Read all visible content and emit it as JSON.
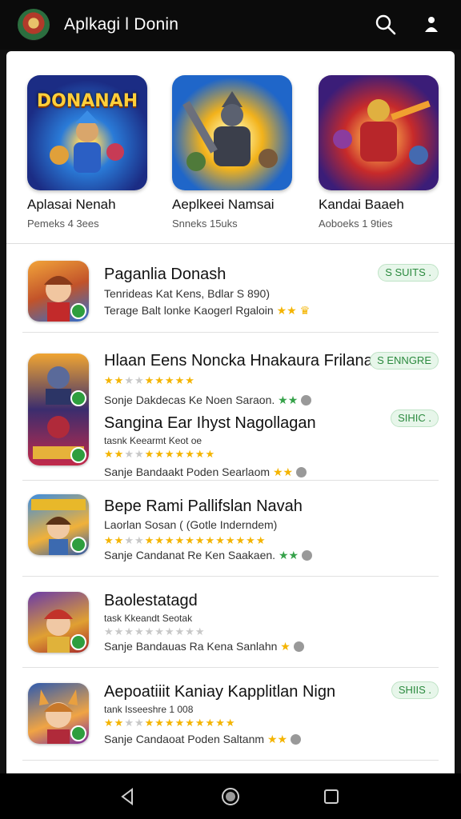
{
  "header": {
    "title": "Aplkagi l Donin",
    "logo_icon": "game-logo",
    "search_icon": "search-icon",
    "account_icon": "account-icon"
  },
  "featured": [
    {
      "name": "Aplasai Nenah",
      "meta": "Pemeks    4 3ees",
      "banner": "DONANAH"
    },
    {
      "name": "Aeplkeei Namsai",
      "meta": "Snneks    15uks",
      "banner": ""
    },
    {
      "name": "Kandai Baaeh",
      "meta": "Aoboeks    1 9ties",
      "banner": ""
    }
  ],
  "list": [
    {
      "name": "Paganlia Donash",
      "sub": "Tenrideas Kat Kens,  Bdlar S 890)",
      "dev": "Terage Balt lonke Kaogerl Rgaloin",
      "rating": 0,
      "pill": "S SUITS ."
    },
    {
      "name": "Hlaan Eens Noncka Hnakaura Frilanah",
      "sub": "",
      "dev": "Sonje Dakdecas Ke Noen Saraon.",
      "rating": 2.5,
      "pill": "S ENNGRE"
    },
    {
      "name": "Sangina Ear Ihyst Nagollagan",
      "sub": "tasnk Keearmt Keot oe",
      "dev": "Sanje Bandaakt Poden Searlaom",
      "rating": 2.5,
      "pill": "SIHIC ."
    },
    {
      "name": "Bepe Rami Pallifslan Navah",
      "sub": "Laorlan Sosan ( (Gotle Inderndem)",
      "dev": "Sanje Candanat Re Ken Saakaen.",
      "rating": 2.5,
      "pill": ""
    },
    {
      "name": "Baolestatagd",
      "sub": "task Kkeandt Seotak",
      "dev": "Sanje Bandauas Ra Kena Sanlahn",
      "rating": 0,
      "pill": ""
    },
    {
      "name": "Aepoatiiit Kaniay Kapplitlan Nign",
      "sub": "tank Isseeshre 1 008",
      "dev": "Sanje Candaoat Poden Saltanm",
      "rating": 2.5,
      "pill": "SHIIS ."
    }
  ],
  "navbar": {
    "back_icon": "back-icon",
    "home_icon": "home-icon",
    "recents_icon": "recents-icon"
  },
  "colors": {
    "topbar": "#0b0b0b",
    "accent_green": "#2e9e3e",
    "star": "#f4b400"
  }
}
